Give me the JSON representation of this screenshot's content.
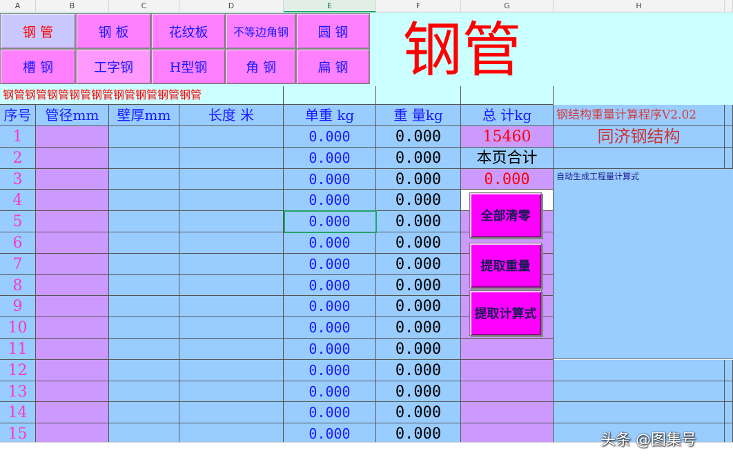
{
  "columns": [
    "A",
    "B",
    "C",
    "D",
    "E",
    "F",
    "G",
    "H"
  ],
  "nav": {
    "row1": [
      "钢  管",
      "钢  板",
      "花纹板",
      "不等边角钢",
      "圆  钢"
    ],
    "row2": [
      "槽  钢",
      "工字钢",
      "H型钢",
      "角  钢",
      "扁  钢"
    ]
  },
  "title": "钢管",
  "banner": "钢管钢管钢管钢管钢管钢管钢管钢管钢管",
  "headers": [
    "序号",
    "管径mm",
    "壁厚mm",
    "长度 米",
    "单重 kg",
    "重  量kg",
    "总  计kg"
  ],
  "program_title": "钢结构重量计算程序V2.02",
  "total_value": "15460",
  "firm": "同济钢结构",
  "page_total_label": "本页合计",
  "page_total_value": "0.000",
  "auto_formula_label": "自动生成工程量计算式",
  "rows": [
    {
      "no": "1",
      "unit": "0.000",
      "weight": "0.000"
    },
    {
      "no": "2",
      "unit": "0.000",
      "weight": "0.000"
    },
    {
      "no": "3",
      "unit": "0.000",
      "weight": "0.000"
    },
    {
      "no": "4",
      "unit": "0.000",
      "weight": "0.000"
    },
    {
      "no": "5",
      "unit": "0.000",
      "weight": "0.000"
    },
    {
      "no": "6",
      "unit": "0.000",
      "weight": "0.000"
    },
    {
      "no": "7",
      "unit": "0.000",
      "weight": "0.000"
    },
    {
      "no": "8",
      "unit": "0.000",
      "weight": "0.000"
    },
    {
      "no": "9",
      "unit": "0.000",
      "weight": "0.000"
    },
    {
      "no": "10",
      "unit": "0.000",
      "weight": "0.000"
    },
    {
      "no": "11",
      "unit": "0.000",
      "weight": "0.000"
    },
    {
      "no": "12",
      "unit": "0.000",
      "weight": "0.000"
    },
    {
      "no": "13",
      "unit": "0.000",
      "weight": "0.000"
    },
    {
      "no": "14",
      "unit": "0.000",
      "weight": "0.000"
    },
    {
      "no": "15",
      "unit": "0.000",
      "weight": "0.000"
    }
  ],
  "macros": [
    "全部清零",
    "提取重量",
    "提取计算式"
  ],
  "watermark": "头条 @图集号",
  "colors": {
    "red": "#ff0000",
    "blue": "#99ccff",
    "purple": "#cc99ff",
    "magenta": "#ff00ff",
    "cyan": "#ccffff"
  }
}
